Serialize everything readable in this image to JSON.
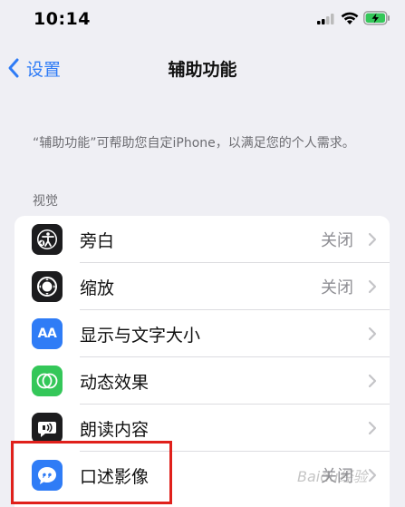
{
  "status_bar": {
    "time": "10:14"
  },
  "nav": {
    "back_label": "设置",
    "title": "辅助功能"
  },
  "description": "“辅助功能”可帮助您自定iPhone，以满足您的个人需求。",
  "section_header": "视觉",
  "rows": [
    {
      "label": "旁白",
      "value": "关闭",
      "icon": "voiceover-icon",
      "icon_bg": "#1c1c1e"
    },
    {
      "label": "缩放",
      "value": "关闭",
      "icon": "zoom-icon",
      "icon_bg": "#1c1c1e"
    },
    {
      "label": "显示与文字大小",
      "value": "",
      "icon": "text-size-icon",
      "icon_bg": "#2f7cf6",
      "icon_text": "AA"
    },
    {
      "label": "动态效果",
      "value": "",
      "icon": "motion-icon",
      "icon_bg": "#34c759"
    },
    {
      "label": "朗读内容",
      "value": "",
      "icon": "spoken-content-icon",
      "icon_bg": "#1c1c1e"
    },
    {
      "label": "口述影像",
      "value": "关闭",
      "icon": "audio-descriptions-icon",
      "icon_bg": "#2f7cf6"
    }
  ],
  "colors": {
    "accent": "#2f7cf6",
    "highlight": "#e0201b",
    "background": "#efeff4"
  },
  "watermark": "Baidu经验"
}
